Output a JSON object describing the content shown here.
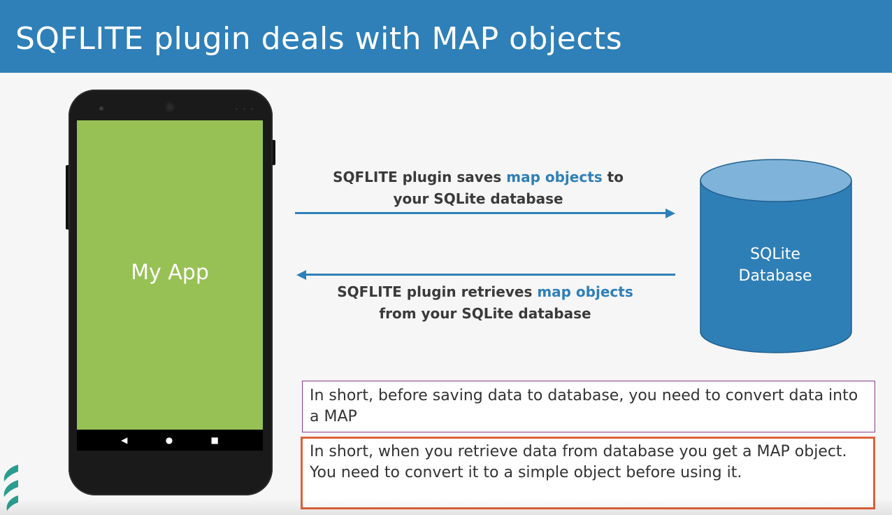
{
  "slide": {
    "title": "SQFLITE plugin deals with MAP objects"
  },
  "phone": {
    "app_label": "My App",
    "nav": {
      "back": "◀",
      "home": "●",
      "recent": "■"
    }
  },
  "save_arrow": {
    "line1_pre": "SQFLITE plugin saves ",
    "line1_accent": "map objects",
    "line1_post": " to",
    "line2": "your SQLite database"
  },
  "retrieve_arrow": {
    "line1_pre": "SQFLITE plugin retrieves ",
    "line1_accent": "map objects",
    "line2": "from your SQLite database"
  },
  "database": {
    "line1": "SQLite",
    "line2": "Database"
  },
  "notes": {
    "save_note": "In short, before saving data to database, you need to convert data into a MAP",
    "retrieve_note": "In short, when you retrieve data from database you get a MAP object. You need to convert it to a simple object before using it."
  },
  "colors": {
    "header": "#2f80b8",
    "accent": "#2f80b8",
    "screen": "#97c154",
    "note_border_1": "#8b3a8b",
    "note_border_2": "#e0623a"
  }
}
